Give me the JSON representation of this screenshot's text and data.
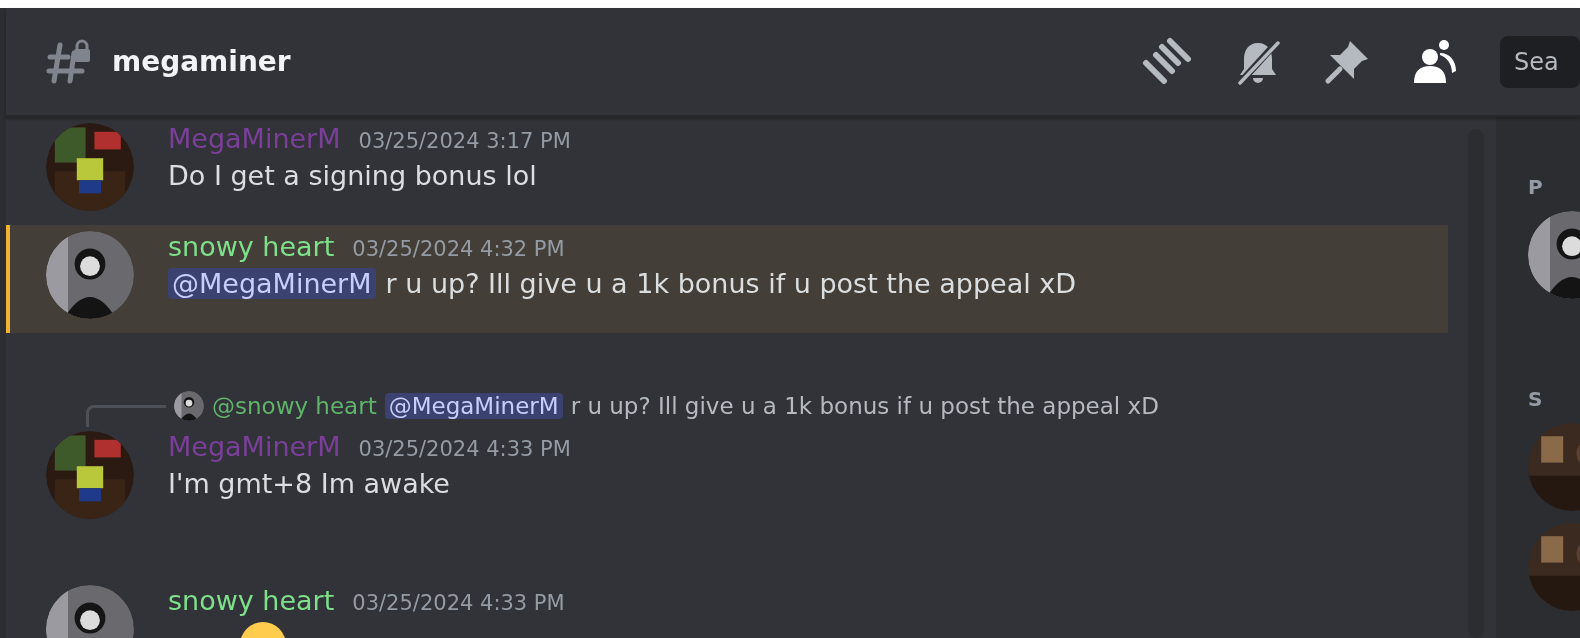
{
  "channel": {
    "name": "megaminer"
  },
  "toolbar": {
    "search": {
      "placeholder": "Sea"
    }
  },
  "messages": [
    {
      "author": "MegaMinerM",
      "color": "#7b3f9a",
      "avatar": {
        "kind": "picture"
      },
      "timestamp": "03/25/2024 3:17 PM",
      "highlighted": false,
      "body": [
        {
          "kind": "text",
          "text": "Do I get a signing bonus lol"
        }
      ]
    },
    {
      "author": "snowy heart",
      "color": "#7ee08a",
      "avatar": {
        "kind": "picture"
      },
      "timestamp": "03/25/2024 4:32 PM",
      "highlighted": true,
      "body": [
        {
          "kind": "mention",
          "text": "@MegaMinerM"
        },
        {
          "kind": "text",
          "text": "r u up? Ill give u a 1k bonus if u post the appeal xD"
        }
      ]
    },
    {
      "author": "MegaMinerM",
      "color": "#7b3f9a",
      "avatar": {
        "kind": "picture"
      },
      "timestamp": "03/25/2024 4:33 PM",
      "highlighted": false,
      "reply": {
        "author": "@snowy heart",
        "color": "#5fb36a",
        "mention": "@MegaMinerM",
        "text": "r u up? Ill give u a 1k bonus if u post the appeal xD"
      },
      "body": [
        {
          "kind": "text",
          "text": "I'm gmt+8 Im awake"
        }
      ]
    },
    {
      "author": "snowy heart",
      "color": "#7ee08a",
      "avatar": {
        "kind": "picture"
      },
      "timestamp": "03/25/2024 4:33 PM",
      "highlighted": false,
      "body": [
        {
          "kind": "emoji"
        }
      ]
    }
  ],
  "member_list": {
    "sections": [
      {
        "title": "P",
        "members": [
          {
            "kind": "picture"
          }
        ]
      },
      {
        "title": "S",
        "members": [
          {
            "kind": "picture"
          },
          {
            "kind": "picture"
          }
        ]
      }
    ]
  }
}
